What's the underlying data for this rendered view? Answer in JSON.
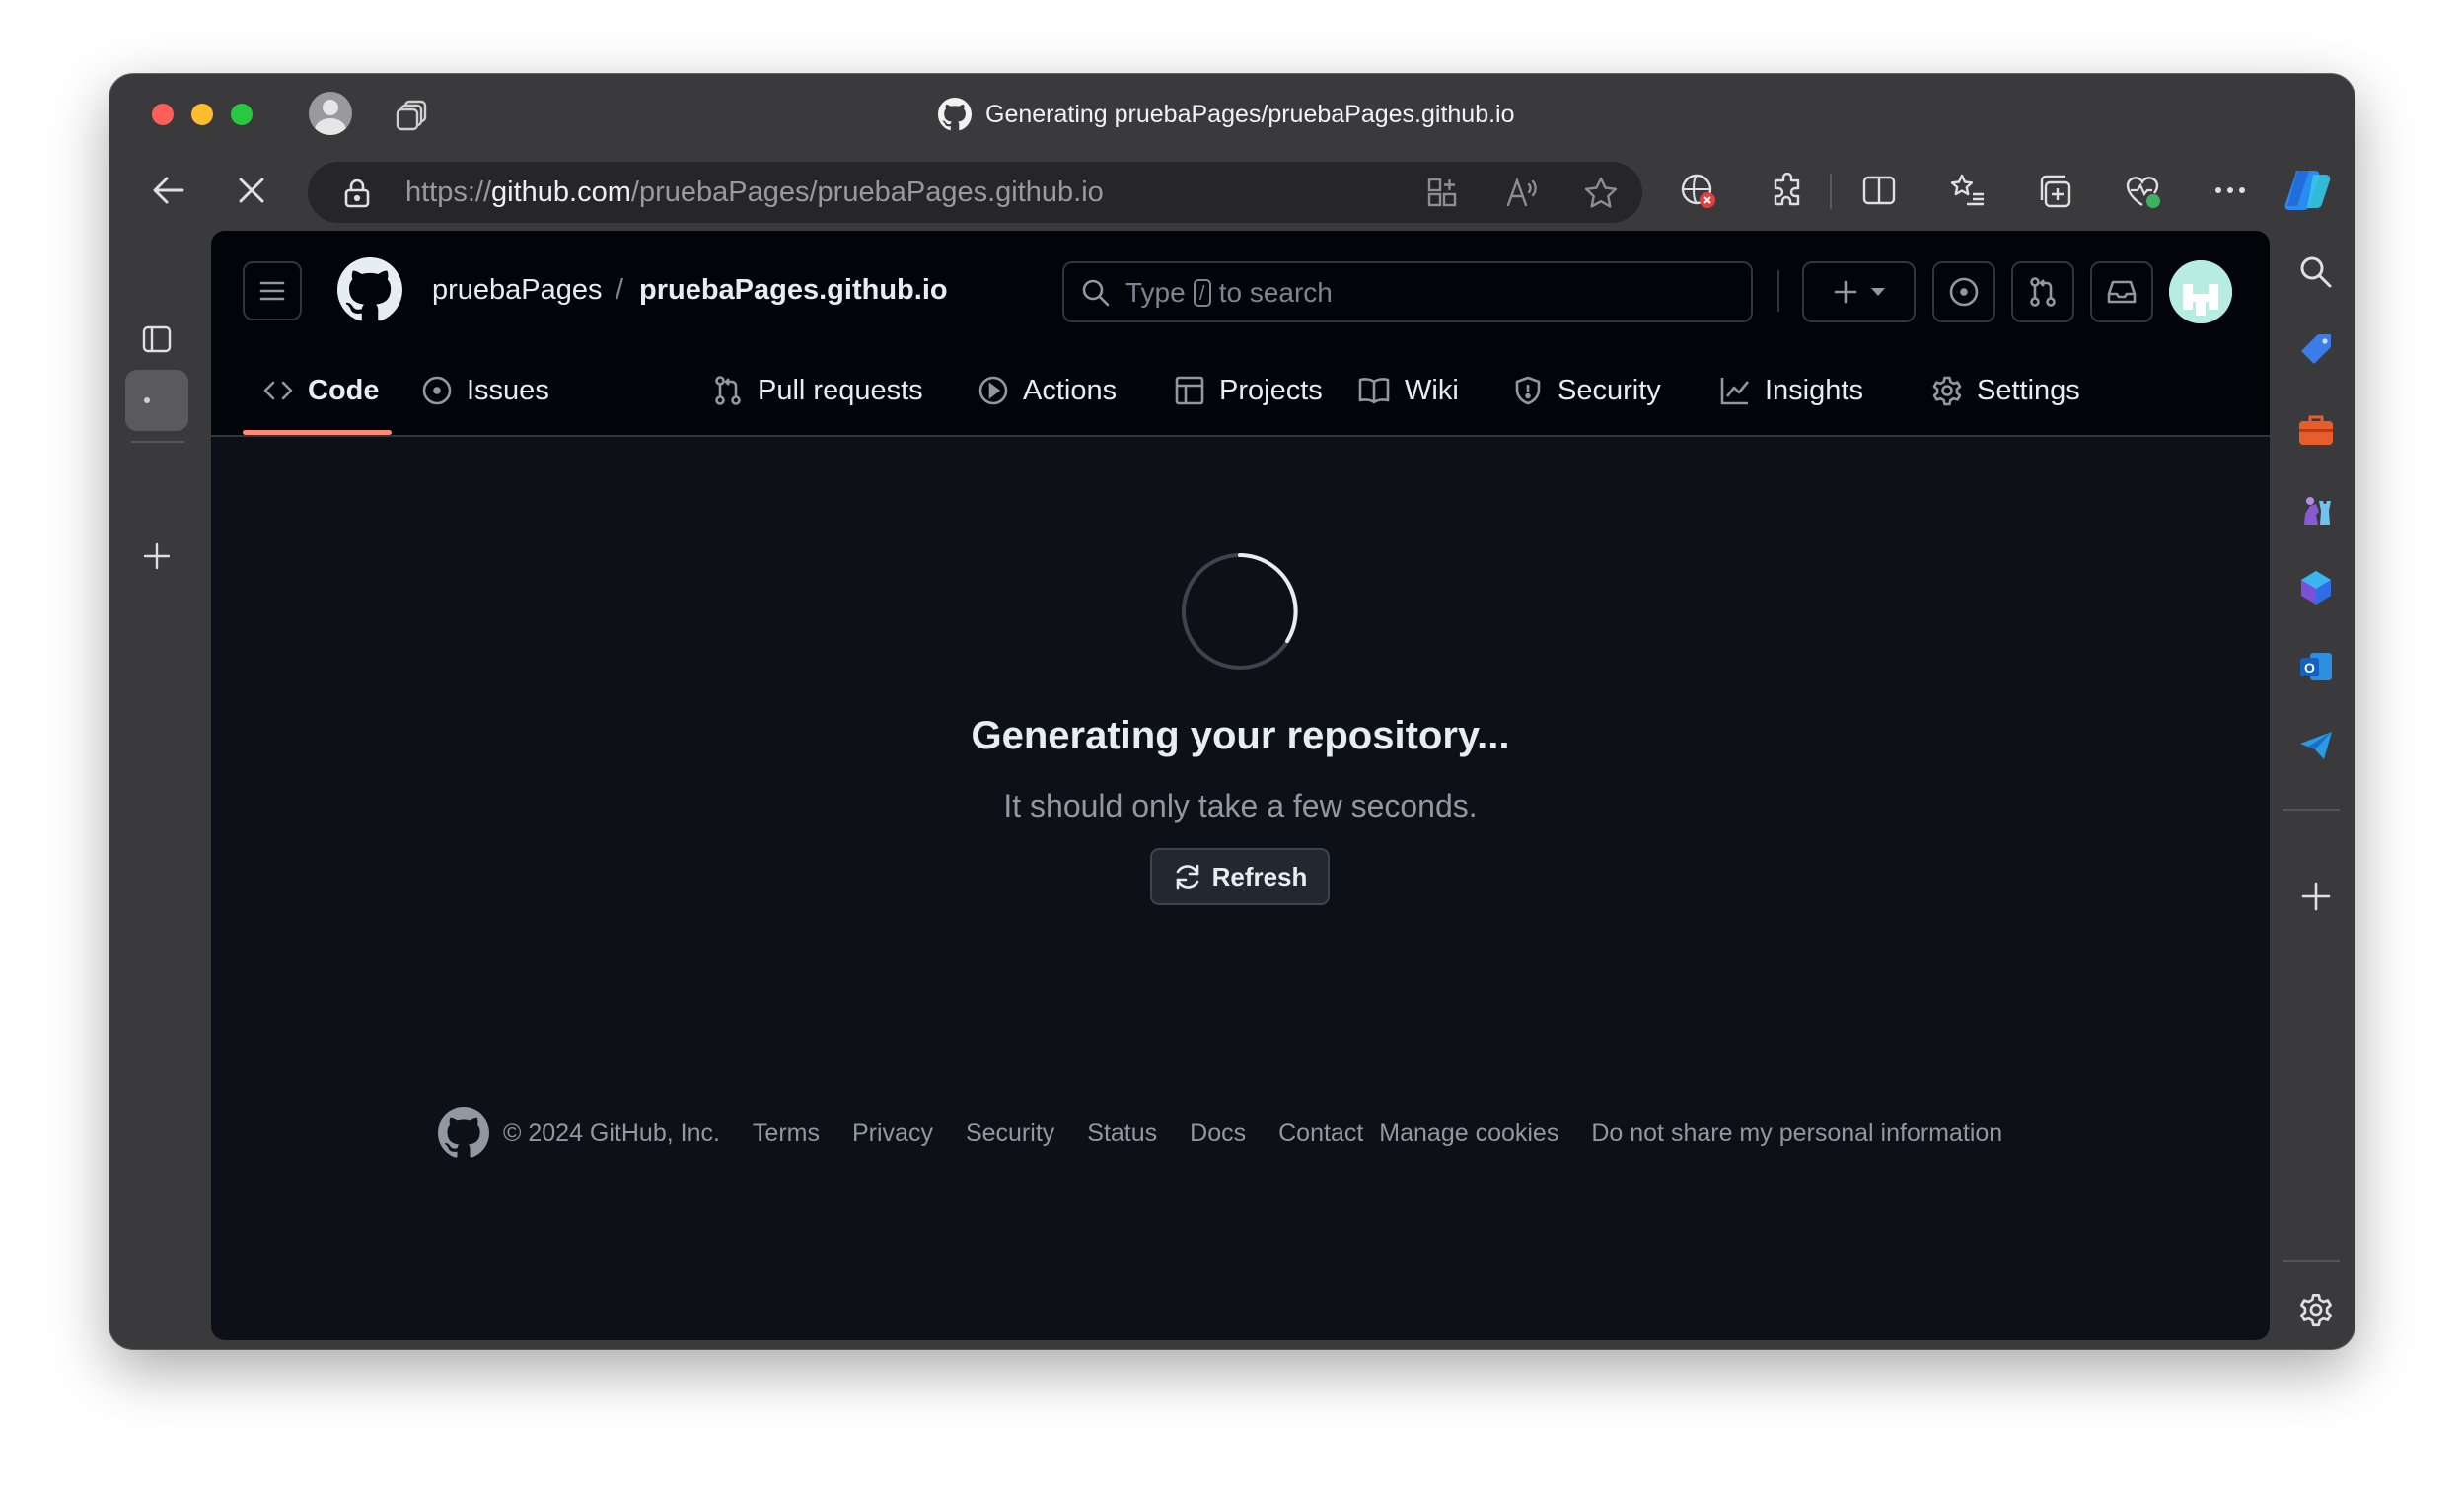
{
  "browser": {
    "tab_title": "Generating pruebaPages/pruebaPages.github.io",
    "url_prefix": "https://",
    "url_domain": "github.com",
    "url_path": "/pruebaPages/pruebaPages.github.io"
  },
  "header": {
    "owner": "pruebaPages",
    "separator": "/",
    "repo": "pruebaPages.github.io",
    "search_pre": "Type",
    "search_key": "/",
    "search_post": "to search"
  },
  "nav": {
    "code": "Code",
    "issues": "Issues",
    "pull_requests": "Pull requests",
    "actions": "Actions",
    "projects": "Projects",
    "wiki": "Wiki",
    "security": "Security",
    "insights": "Insights",
    "settings": "Settings"
  },
  "main": {
    "title": "Generating your repository...",
    "subtitle": "It should only take a few seconds.",
    "refresh_label": "Refresh"
  },
  "footer": {
    "copyright": "© 2024 GitHub, Inc.",
    "links": [
      "Terms",
      "Privacy",
      "Security",
      "Status",
      "Docs",
      "Contact",
      "Manage cookies",
      "Do not share my personal information"
    ]
  },
  "colors": {
    "page_bg": "#0d1117",
    "header_bg": "#010409",
    "active_tab_underline": "#fd8c73",
    "window_chrome": "#3a3a3c"
  }
}
